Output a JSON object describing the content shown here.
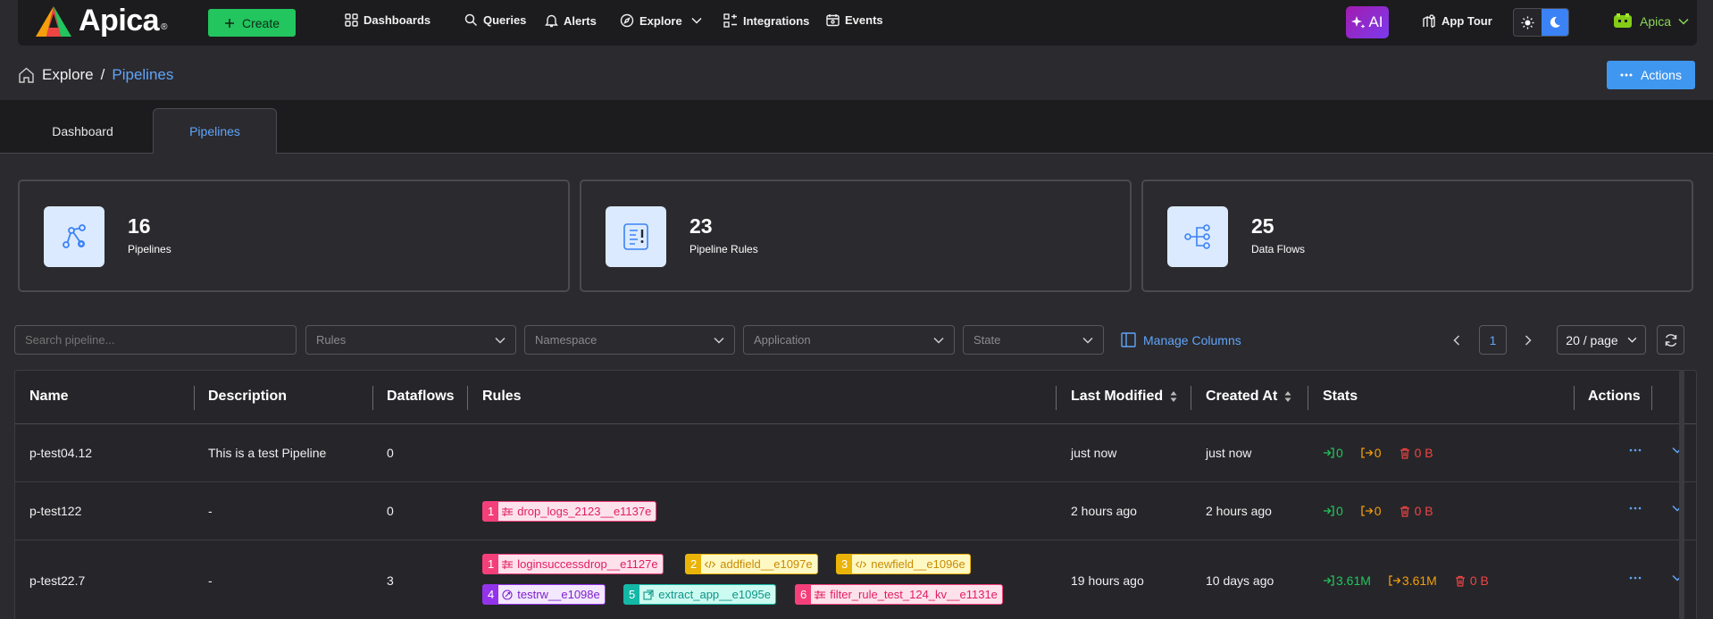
{
  "header": {
    "brand": "Apica",
    "brand_mark": "®",
    "create_label": "Create",
    "nav": [
      {
        "label": "Dashboards",
        "icon": "grid-icon"
      },
      {
        "label": "Queries",
        "icon": "search-icon"
      },
      {
        "label": "Alerts",
        "icon": "bell-icon"
      },
      {
        "label": "Explore",
        "icon": "compass-icon"
      },
      {
        "label": "Integrations",
        "icon": "integrations-icon"
      },
      {
        "label": "Events",
        "icon": "calendar-icon"
      }
    ],
    "ai_label": "AI",
    "app_tour_label": "App Tour",
    "user_label": "Apica"
  },
  "breadcrumb": {
    "root": "Explore",
    "separator": "/",
    "current": "Pipelines"
  },
  "page_actions_label": "Actions",
  "tabs": [
    {
      "label": "Dashboard",
      "active": false
    },
    {
      "label": "Pipelines",
      "active": true
    }
  ],
  "stats_cards": [
    {
      "value": "16",
      "label": "Pipelines",
      "icon": "pipeline-network-icon"
    },
    {
      "value": "23",
      "label": "Pipeline Rules",
      "icon": "rules-list-icon"
    },
    {
      "value": "25",
      "label": "Data Flows",
      "icon": "data-flow-icon"
    }
  ],
  "filters": {
    "search_placeholder": "Search pipeline...",
    "rules_placeholder": "Rules",
    "namespace_placeholder": "Namespace",
    "application_placeholder": "Application",
    "state_placeholder": "State",
    "manage_columns_label": "Manage Columns"
  },
  "pagination": {
    "current_page": "1",
    "page_size": "20 / page"
  },
  "table": {
    "columns": [
      "Name",
      "Description",
      "Dataflows",
      "Rules",
      "Last Modified",
      "Created At",
      "Stats",
      "Actions"
    ],
    "rows": [
      {
        "name": "p-test04.12",
        "description": "This is a test Pipeline",
        "dataflows": "0",
        "rules": [],
        "last_modified": "just now",
        "created_at": "just now",
        "stats": {
          "in": "0",
          "out": "0",
          "dropped": "0 B"
        }
      },
      {
        "name": "p-test122",
        "description": "-",
        "dataflows": "0",
        "rules": [
          {
            "index": "1",
            "name": "drop_logs_2123__e1137e",
            "kind": "filter",
            "color": "#f43f7a"
          }
        ],
        "last_modified": "2 hours ago",
        "created_at": "2 hours ago",
        "stats": {
          "in": "0",
          "out": "0",
          "dropped": "0 B"
        }
      },
      {
        "name": "p-test22.7",
        "description": "-",
        "dataflows": "3",
        "rules": [
          {
            "index": "1",
            "name": "loginsuccessdrop__e1127e",
            "kind": "filter",
            "color": "#f43f7a"
          },
          {
            "index": "2",
            "name": "addfield__e1097e",
            "kind": "code",
            "color": "#eab308"
          },
          {
            "index": "3",
            "name": "newfield__e1096e",
            "kind": "code",
            "color": "#eab308"
          },
          {
            "index": "4",
            "name": "testrw__e1098e",
            "kind": "rewrite",
            "color": "#9333ea"
          },
          {
            "index": "5",
            "name": "extract_app__e1095e",
            "kind": "extract",
            "color": "#14b8a6"
          },
          {
            "index": "6",
            "name": "filter_rule_test_124_kv__e1131e",
            "kind": "filter",
            "color": "#f43f7a"
          }
        ],
        "last_modified": "19 hours ago",
        "created_at": "10 days ago",
        "stats": {
          "in": "3.61M",
          "out": "3.61M",
          "dropped": "0 B"
        }
      }
    ]
  },
  "colors": {
    "accent": "#3b82f6",
    "create_green": "#22c55e",
    "stat_in": "#22c55e",
    "stat_out": "#f59e0b",
    "stat_dropped": "#ef4444"
  }
}
